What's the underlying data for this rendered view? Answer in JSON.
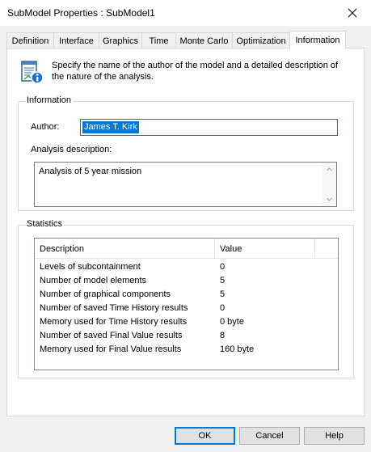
{
  "window": {
    "title": "SubModel Properties : SubModel1"
  },
  "tabs": [
    {
      "label": "Definition"
    },
    {
      "label": "Interface"
    },
    {
      "label": "Graphics"
    },
    {
      "label": "Time"
    },
    {
      "label": "Monte Carlo"
    },
    {
      "label": "Optimization"
    },
    {
      "label": "Information",
      "active": true
    }
  ],
  "intro": {
    "icon": "document-info-icon",
    "text": "Specify the name of the author of the model and a detailed description of the nature of the analysis."
  },
  "information": {
    "group_label": "Information",
    "author_label": "Author:",
    "author_value": "James T. Kirk",
    "description_label": "Analysis description:",
    "description_value": "Analysis of 5 year mission"
  },
  "statistics": {
    "group_label": "Statistics",
    "columns": [
      "Description",
      "Value"
    ],
    "rows": [
      {
        "description": "Levels of subcontainment",
        "value": "0"
      },
      {
        "description": "Number of model elements",
        "value": "5"
      },
      {
        "description": "Number of graphical components",
        "value": "5"
      },
      {
        "description": "Number of saved Time History results",
        "value": "0"
      },
      {
        "description": "Memory used for Time History results",
        "value": "0 byte"
      },
      {
        "description": "Number of saved Final Value results",
        "value": "8"
      },
      {
        "description": "Memory used for Final Value results",
        "value": "160 byte"
      }
    ]
  },
  "buttons": {
    "ok": "OK",
    "cancel": "Cancel",
    "help": "Help"
  },
  "colors": {
    "accent": "#0078d7",
    "panel": "#ffffff",
    "chrome": "#f0f0f0"
  }
}
